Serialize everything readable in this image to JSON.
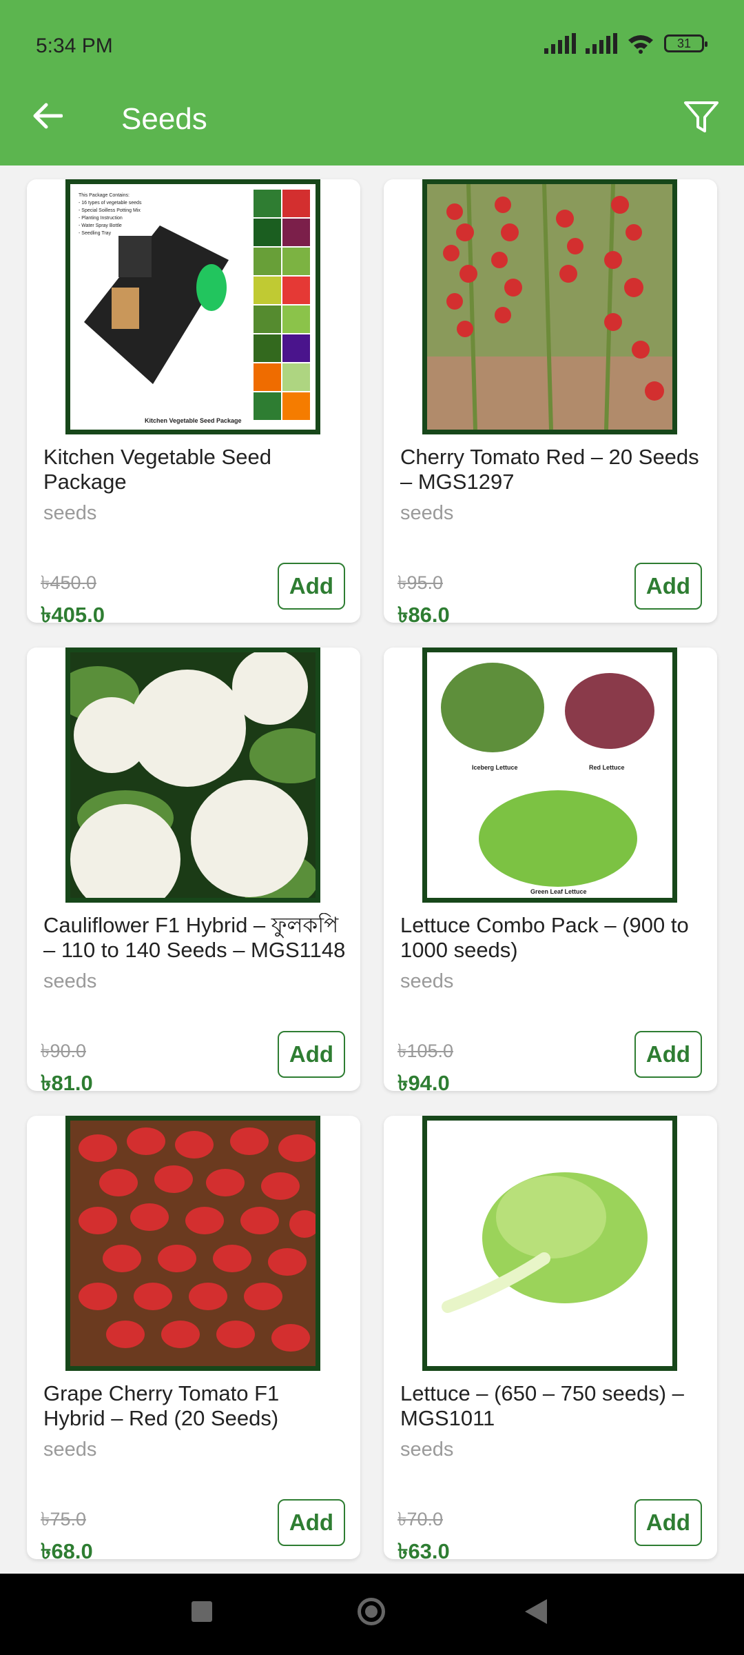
{
  "status_bar": {
    "time": "5:34 PM",
    "battery": "31"
  },
  "app_bar": {
    "title": "Seeds",
    "back_icon": "arrow-left-icon",
    "filter_icon": "filter-icon"
  },
  "products": [
    {
      "name": "Kitchen Vegetable Seed Package",
      "category": "seeds",
      "old_price": "৳450.0",
      "price": "৳405.0",
      "add_label": "Add",
      "image_caption": "Kitchen Vegetable Seed Package",
      "image_text": "This Package Contains:\n- 16 types of vegetable seeds\n- Special Soilless Potting Mix\n- Planting Instruction\n- Water Spray Bottle\n- Seedling Tray"
    },
    {
      "name": "Cherry Tomato Red – 20 Seeds – MGS1297",
      "category": "seeds",
      "old_price": "৳95.0",
      "price": "৳86.0",
      "add_label": "Add"
    },
    {
      "name": "Cauliflower F1 Hybrid – ফুলকপি – 110 to 140 Seeds – MGS1148",
      "category": "seeds",
      "old_price": "৳90.0",
      "price": "৳81.0",
      "add_label": "Add"
    },
    {
      "name": "Lettuce Combo Pack – (900 to 1000 seeds)",
      "category": "seeds",
      "old_price": "৳105.0",
      "price": "৳94.0",
      "add_label": "Add",
      "image_labels": [
        "Iceberg Lettuce",
        "Red Lettuce",
        "Green Leaf Lettuce"
      ]
    },
    {
      "name": "Grape Cherry Tomato F1 Hybrid – Red (20 Seeds)",
      "category": "seeds",
      "old_price": "৳75.0",
      "price": "৳68.0",
      "add_label": "Add"
    },
    {
      "name": "Lettuce – (650 – 750 seeds) – MGS1011",
      "category": "seeds",
      "old_price": "৳70.0",
      "price": "৳63.0",
      "add_label": "Add"
    }
  ],
  "colors": {
    "app_bar": "#5cb54f",
    "price": "#2e7d32",
    "image_border": "#17471a"
  }
}
